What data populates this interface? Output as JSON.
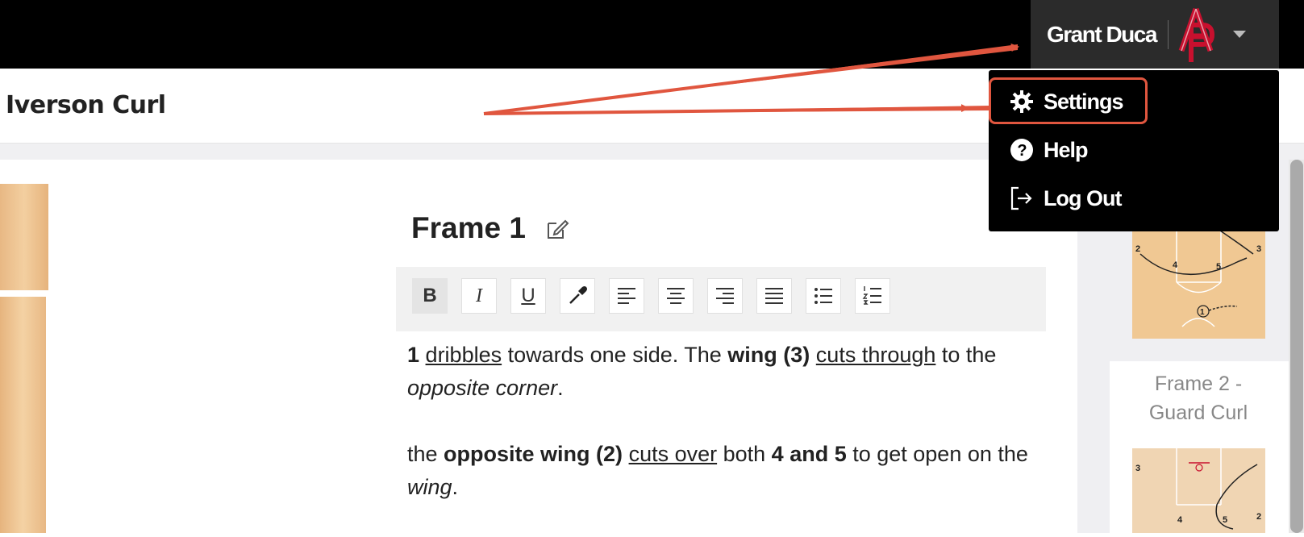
{
  "header": {
    "user_name": "Grant Duca",
    "logo_icon": "ap-monogram-logo",
    "caret_icon": "caret-down-icon"
  },
  "play": {
    "title": "Iverson Curl"
  },
  "menu": {
    "items": [
      {
        "label": "Settings",
        "icon": "gear-icon"
      },
      {
        "label": "Help",
        "icon": "question-circle-icon"
      },
      {
        "label": "Log Out",
        "icon": "logout-icon"
      }
    ]
  },
  "frame": {
    "heading": "Frame 1"
  },
  "toolbar": {
    "bold": "B",
    "italic": "I",
    "underline": "U"
  },
  "editor": {
    "p1": {
      "t1": "1",
      "t2": " ",
      "t3": "dribbles",
      "t4": " towards one side. The ",
      "t5": "wing (3)",
      "t6": " ",
      "t7": "cuts through",
      "t8": " to the ",
      "t9": "opposite corner",
      "t10": "."
    },
    "p2": {
      "t1": "the ",
      "t2": "opposite wing (2)",
      "t3": " ",
      "t4": "cuts over",
      "t5": " both ",
      "t6": "4 and 5",
      "t7": " to get open on the ",
      "t8": "wing",
      "t9": "."
    }
  },
  "sidebar": {
    "frame2_label_line1": "Frame 2 -",
    "frame2_label_line2": "Guard Curl",
    "thumb1_numbers": [
      "2",
      "4",
      "5",
      "3",
      "1"
    ],
    "thumb2_numbers": [
      "3",
      "4",
      "5",
      "2"
    ]
  },
  "colors": {
    "annotation": "#e0563f",
    "topbar": "#000000",
    "court": "#f0c893"
  }
}
